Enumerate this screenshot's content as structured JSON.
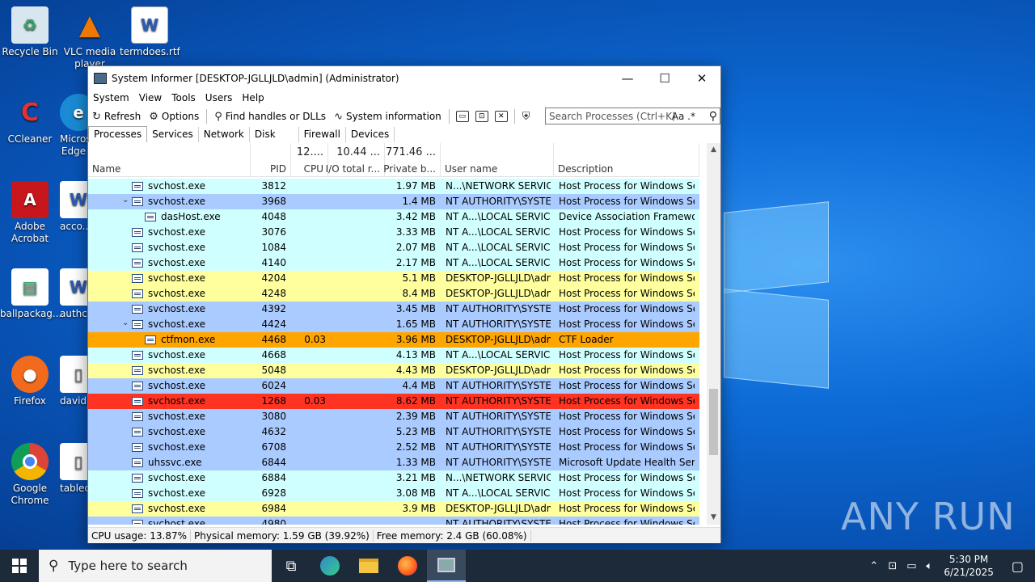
{
  "desktop_icons": [
    {
      "label": "Recycle Bin",
      "icon": "recycle-bin-icon"
    },
    {
      "label": "VLC media player",
      "icon": "vlc-icon"
    },
    {
      "label": "termdoes.rtf",
      "icon": "word-doc-icon"
    },
    {
      "label": "CCleaner",
      "icon": "ccleaner-icon"
    },
    {
      "label": "Microsoft Edge",
      "icon": "edge-icon"
    },
    {
      "label": "Adobe Acrobat",
      "icon": "acrobat-icon"
    },
    {
      "label": "acco...",
      "icon": "word-doc-icon"
    },
    {
      "label": "ballpackag...",
      "icon": "image-file-icon"
    },
    {
      "label": "authc...",
      "icon": "word-doc-icon"
    },
    {
      "label": "Firefox",
      "icon": "firefox-icon"
    },
    {
      "label": "david...",
      "icon": "file-icon"
    },
    {
      "label": "Google Chrome",
      "icon": "chrome-icon"
    },
    {
      "label": "tablec...",
      "icon": "file-icon"
    }
  ],
  "watermark": "ANY RUN",
  "window": {
    "title": "System Informer [DESKTOP-JGLLJLD\\admin] (Administrator)",
    "minimize": "—",
    "maximize": "☐",
    "close": "✕"
  },
  "menu": [
    "System",
    "View",
    "Tools",
    "Users",
    "Help"
  ],
  "toolbar": {
    "refresh": "Refresh",
    "options": "Options",
    "find_handles": "Find handles or DLLs",
    "sysinfo": "System information",
    "search_placeholder": "Search Processes (Ctrl+K)",
    "case_toggle": "Aa",
    "regex_toggle": ".*"
  },
  "tabs": [
    "Processes",
    "Services",
    "Network",
    "Disk",
    "Firewall",
    "Devices"
  ],
  "active_tab": "Processes",
  "columns": {
    "name": "Name",
    "pid": "PID",
    "cpu": "CPU",
    "cpu_total": "12....",
    "io": "I/O total r...",
    "io_total": "10.44 ...",
    "private": "Private b...",
    "private_total": "771.46 ...",
    "user": "User name",
    "desc": "Description"
  },
  "colors": {
    "services": "#d0ffff",
    "system": "#aacbff",
    "own": "#ffff9e",
    "selected": "#ffa500",
    "high": "#ff3322"
  },
  "processes": [
    {
      "name": "svchost.exe",
      "indent": 1,
      "expander": "",
      "pid": "3812",
      "cpu": "",
      "private": "1.97 MB",
      "user": "N...\\NETWORK SERVICE",
      "desc": "Host Process for Windows Ser...",
      "color": "services"
    },
    {
      "name": "svchost.exe",
      "indent": 1,
      "expander": "⌄",
      "pid": "3968",
      "cpu": "",
      "private": "1.4 MB",
      "user": "NT AUTHORITY\\SYSTEM",
      "desc": "Host Process for Windows Ser...",
      "color": "system"
    },
    {
      "name": "dasHost.exe",
      "indent": 2,
      "expander": "",
      "pid": "4048",
      "cpu": "",
      "private": "3.42 MB",
      "user": "NT A...\\LOCAL SERVICE",
      "desc": "Device Association Framewor...",
      "color": "services"
    },
    {
      "name": "svchost.exe",
      "indent": 1,
      "expander": "",
      "pid": "3076",
      "cpu": "",
      "private": "3.33 MB",
      "user": "NT A...\\LOCAL SERVICE",
      "desc": "Host Process for Windows Ser...",
      "color": "services"
    },
    {
      "name": "svchost.exe",
      "indent": 1,
      "expander": "",
      "pid": "1084",
      "cpu": "",
      "private": "2.07 MB",
      "user": "NT A...\\LOCAL SERVICE",
      "desc": "Host Process for Windows Ser...",
      "color": "services"
    },
    {
      "name": "svchost.exe",
      "indent": 1,
      "expander": "",
      "pid": "4140",
      "cpu": "",
      "private": "2.17 MB",
      "user": "NT A...\\LOCAL SERVICE",
      "desc": "Host Process for Windows Ser...",
      "color": "services"
    },
    {
      "name": "svchost.exe",
      "indent": 1,
      "expander": "",
      "pid": "4204",
      "cpu": "",
      "private": "5.1 MB",
      "user": "DESKTOP-JGLLJLD\\admi",
      "desc": "Host Process for Windows Ser...",
      "color": "own"
    },
    {
      "name": "svchost.exe",
      "indent": 1,
      "expander": "",
      "pid": "4248",
      "cpu": "",
      "private": "8.4 MB",
      "user": "DESKTOP-JGLLJLD\\admi",
      "desc": "Host Process for Windows Ser...",
      "color": "own"
    },
    {
      "name": "svchost.exe",
      "indent": 1,
      "expander": "",
      "pid": "4392",
      "cpu": "",
      "private": "3.45 MB",
      "user": "NT AUTHORITY\\SYSTEM",
      "desc": "Host Process for Windows Ser...",
      "color": "system"
    },
    {
      "name": "svchost.exe",
      "indent": 1,
      "expander": "⌄",
      "pid": "4424",
      "cpu": "",
      "private": "1.65 MB",
      "user": "NT AUTHORITY\\SYSTEM",
      "desc": "Host Process for Windows Ser...",
      "color": "system"
    },
    {
      "name": "ctfmon.exe",
      "indent": 2,
      "expander": "",
      "pid": "4468",
      "cpu": "0.03",
      "private": "3.96 MB",
      "user": "DESKTOP-JGLLJLD\\admi",
      "desc": "CTF Loader",
      "color": "selected"
    },
    {
      "name": "svchost.exe",
      "indent": 1,
      "expander": "",
      "pid": "4668",
      "cpu": "",
      "private": "4.13 MB",
      "user": "NT A...\\LOCAL SERVICE",
      "desc": "Host Process for Windows Ser...",
      "color": "services"
    },
    {
      "name": "svchost.exe",
      "indent": 1,
      "expander": "",
      "pid": "5048",
      "cpu": "",
      "private": "4.43 MB",
      "user": "DESKTOP-JGLLJLD\\admi",
      "desc": "Host Process for Windows Ser...",
      "color": "own"
    },
    {
      "name": "svchost.exe",
      "indent": 1,
      "expander": "",
      "pid": "6024",
      "cpu": "",
      "private": "4.4 MB",
      "user": "NT AUTHORITY\\SYSTEM",
      "desc": "Host Process for Windows Ser...",
      "color": "system"
    },
    {
      "name": "svchost.exe",
      "indent": 1,
      "expander": "",
      "pid": "1268",
      "cpu": "0.03",
      "private": "8.62 MB",
      "user": "NT AUTHORITY\\SYSTEM",
      "desc": "Host Process for Windows Ser...",
      "color": "high"
    },
    {
      "name": "svchost.exe",
      "indent": 1,
      "expander": "",
      "pid": "3080",
      "cpu": "",
      "private": "2.39 MB",
      "user": "NT AUTHORITY\\SYSTEM",
      "desc": "Host Process for Windows Ser...",
      "color": "system"
    },
    {
      "name": "svchost.exe",
      "indent": 1,
      "expander": "",
      "pid": "4632",
      "cpu": "",
      "private": "5.23 MB",
      "user": "NT AUTHORITY\\SYSTEM",
      "desc": "Host Process for Windows Ser...",
      "color": "system"
    },
    {
      "name": "svchost.exe",
      "indent": 1,
      "expander": "",
      "pid": "6708",
      "cpu": "",
      "private": "2.52 MB",
      "user": "NT AUTHORITY\\SYSTEM",
      "desc": "Host Process for Windows Ser...",
      "color": "system"
    },
    {
      "name": "uhssvc.exe",
      "indent": 1,
      "expander": "",
      "pid": "6844",
      "cpu": "",
      "private": "1.33 MB",
      "user": "NT AUTHORITY\\SYSTEM",
      "desc": "Microsoft Update Health Servi...",
      "color": "system"
    },
    {
      "name": "svchost.exe",
      "indent": 1,
      "expander": "",
      "pid": "6884",
      "cpu": "",
      "private": "3.21 MB",
      "user": "N...\\NETWORK SERVICE",
      "desc": "Host Process for Windows Ser...",
      "color": "services"
    },
    {
      "name": "svchost.exe",
      "indent": 1,
      "expander": "",
      "pid": "6928",
      "cpu": "",
      "private": "3.08 MB",
      "user": "NT A...\\LOCAL SERVICE",
      "desc": "Host Process for Windows Ser...",
      "color": "services"
    },
    {
      "name": "svchost.exe",
      "indent": 1,
      "expander": "",
      "pid": "6984",
      "cpu": "",
      "private": "3.9 MB",
      "user": "DESKTOP-JGLLJLD\\admi",
      "desc": "Host Process for Windows Ser...",
      "color": "own"
    },
    {
      "name": "svchost.exe",
      "indent": 1,
      "expander": "",
      "pid": "4980",
      "cpu": "",
      "private": "",
      "user": "NT AUTHORITY\\SYSTEM",
      "desc": "Host Process for Windows Ser...",
      "color": "system"
    }
  ],
  "status": {
    "cpu": "CPU usage: 13.87%",
    "physical": "Physical memory: 1.59 GB (39.92%)",
    "free": "Free memory: 2.4 GB (60.08%)"
  },
  "taskbar": {
    "search_placeholder": "Type here to search",
    "apps": [
      "task-view-icon",
      "edge-icon",
      "file-explorer-icon",
      "firefox-icon",
      "system-informer-icon"
    ],
    "time": "5:30 PM",
    "date": "6/21/2025"
  }
}
